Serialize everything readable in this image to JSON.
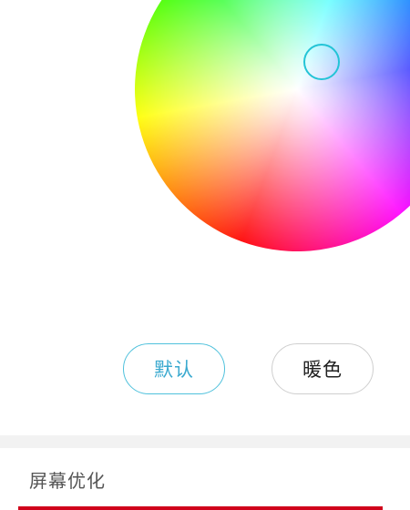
{
  "color_picker": {
    "selector_color": "#23c4d6"
  },
  "buttons": {
    "default_label": "默认",
    "warm_label": "暖色",
    "selected": "default",
    "accent_color": "#4fc1dc"
  },
  "screen_optimization": {
    "title": "屏幕优化"
  },
  "colors": {
    "bottom_bar": "#d0021b"
  }
}
